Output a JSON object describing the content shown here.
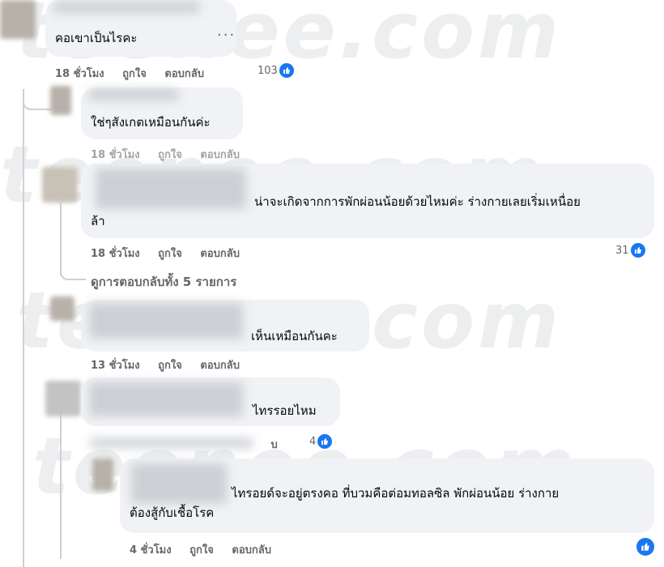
{
  "watermark": "teenee.com",
  "more_options": "...",
  "like_label": "ถูกใจ",
  "reply_label": "ตอบกลับ",
  "comments": [
    {
      "text": "คอเขาเป็นไรคะ",
      "time": "18 ชั่วโมง",
      "reactions": "103"
    },
    {
      "text": "ใช่ๆสังเกตเหมือนกันค่ะ",
      "time": "18 ชั่วโมง",
      "reactions": ""
    },
    {
      "text": "น่าจะเกิดจากการพักผ่อนน้อยด้วยไหมค่ะ ร่างกายเลยเริ่มเหนื่อย",
      "text2": "ล้า",
      "time": "18 ชั่วโมง",
      "reactions": "31"
    },
    {
      "text": "เห็นเหมือนกันคะ",
      "time": "13 ชั่วโมง",
      "reactions": ""
    },
    {
      "text": "ไทรรอยไหม",
      "time": "",
      "reactions": "4"
    },
    {
      "text": "ไทรอยด์จะอยู่ตรงคอ ที่บวมคือต่อมทอลซิล พักผ่อนน้อย ร่างกาย",
      "text2": "ต้องสู้กับเชื้อโรค",
      "time": "4 ชั่วโมง",
      "reactions": ""
    }
  ],
  "view_replies": "ดูการตอบกลับทั้ง 5 รายการ",
  "partial_reply_suffix": "บ",
  "colors": {
    "like_blue": "#1877f2",
    "bubble": "#f0f2f5",
    "meta": "#65676b"
  }
}
